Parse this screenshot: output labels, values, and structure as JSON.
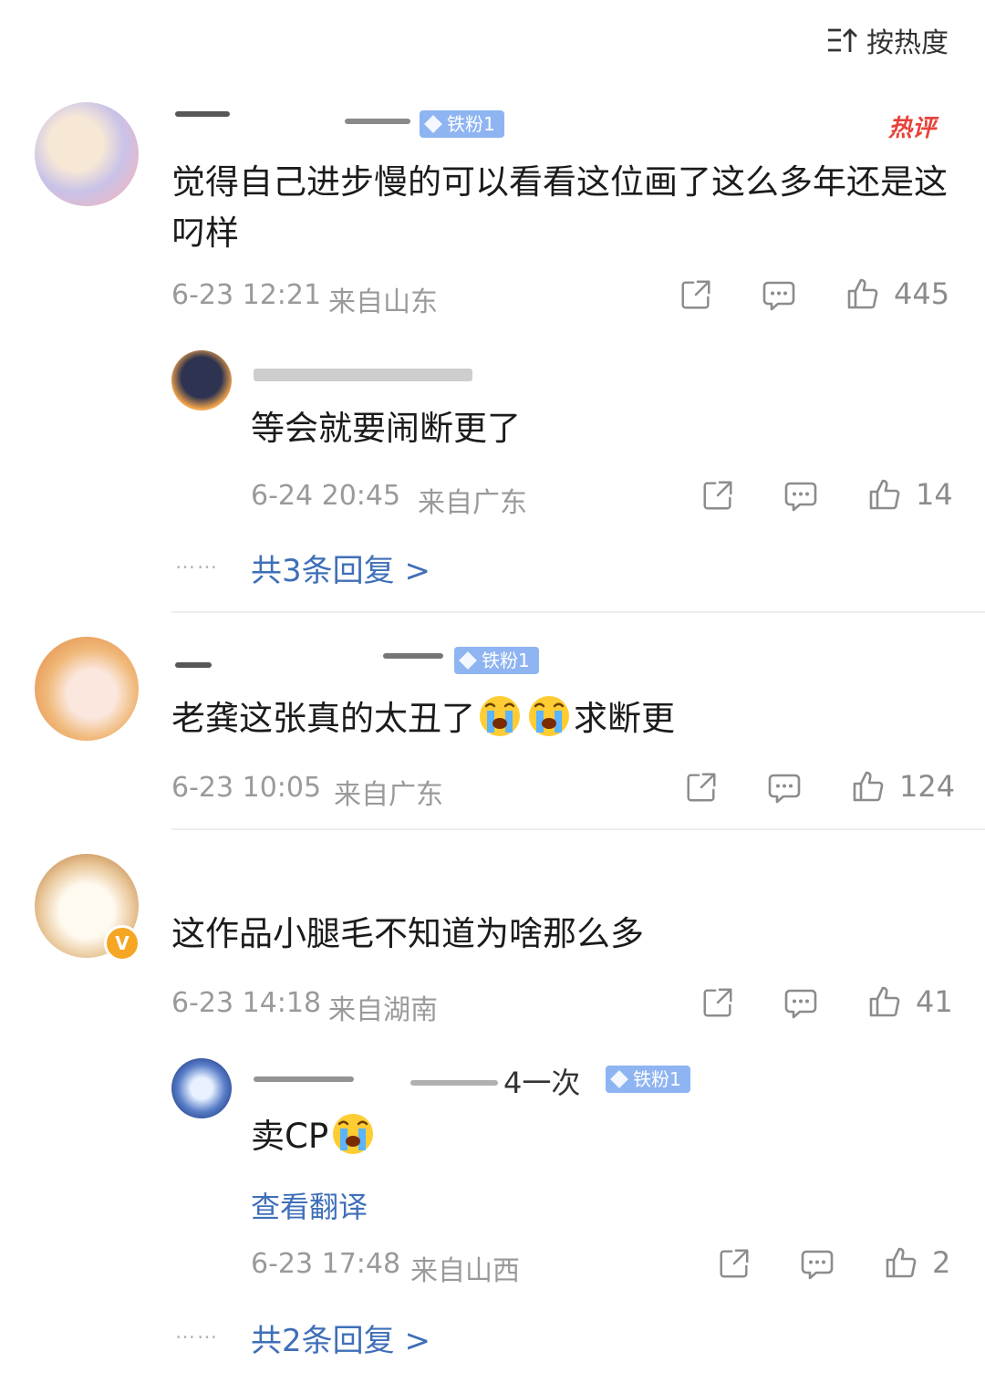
{
  "sort": {
    "label": "按热度"
  },
  "comments": [
    {
      "badge": "铁粉1",
      "hot_label": "热评",
      "text": "觉得自己进步慢的可以看看这位画了这么多年还是这叼样",
      "date": "6-23 12:21",
      "location": "来自山东",
      "likes": "445",
      "reply": {
        "text": "等会就要闹断更了",
        "date": "6-24 20:45",
        "location": "来自广东",
        "likes": "14"
      },
      "more_replies": "共3条回复 >"
    },
    {
      "badge": "铁粉1",
      "text": "老龚这张真的太丑了",
      "text_suffix": "求断更",
      "date": "6-23 10:05",
      "location": "来自广东",
      "likes": "124"
    },
    {
      "verified": "V",
      "text": "这作品小腿毛不知道为啥那么多",
      "date": "6-23 14:18",
      "location": "来自湖南",
      "likes": "41",
      "reply": {
        "name_fragment": "4一次",
        "badge": "铁粉1",
        "text": "卖CP",
        "translate": "查看翻译",
        "date": "6-23 17:48",
        "location": "来自山西",
        "likes": "2"
      },
      "more_replies": "共2条回复 >"
    }
  ],
  "more_dots": "……",
  "colors": {
    "link": "#3f6fb8",
    "hot": "#e8423a",
    "badge": "#8fb4f2",
    "meta": "#9a9a9a"
  },
  "icons": [
    "sort-icon",
    "share-icon",
    "comment-icon",
    "like-icon",
    "crying-emoji",
    "verified-badge"
  ]
}
